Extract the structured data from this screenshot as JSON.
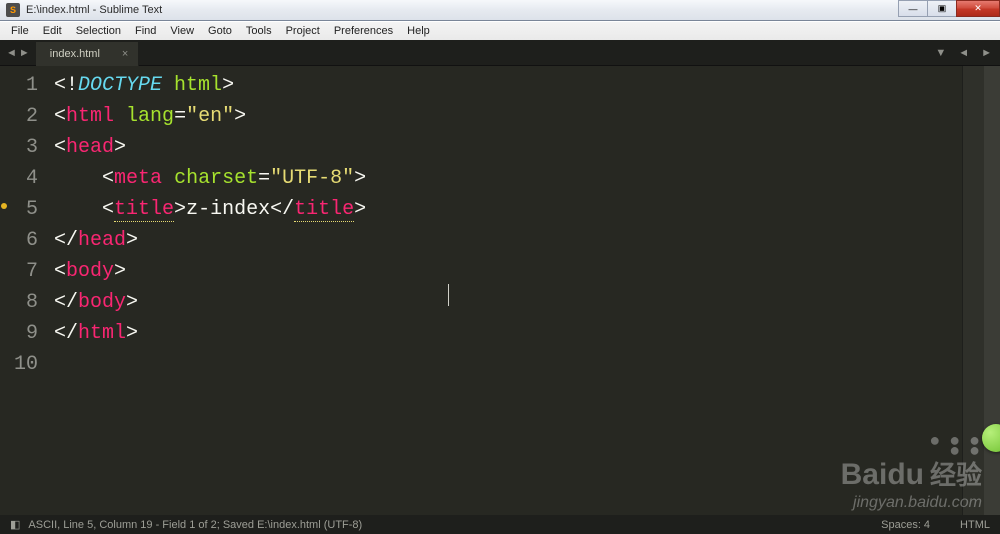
{
  "window": {
    "title": "E:\\index.html - Sublime Text"
  },
  "menu": [
    "File",
    "Edit",
    "Selection",
    "Find",
    "View",
    "Goto",
    "Tools",
    "Project",
    "Preferences",
    "Help"
  ],
  "tab": {
    "label": "index.html"
  },
  "gutter_mark_line": 5,
  "code": {
    "lines": [
      {
        "n": "1",
        "tokens": [
          {
            "t": "<!",
            "c": "tok-punc"
          },
          {
            "t": "DOCTYPE",
            "c": "tok-decl"
          },
          {
            "t": " ",
            "c": "tok-punc"
          },
          {
            "t": "html",
            "c": "tok-attr"
          },
          {
            "t": ">",
            "c": "tok-punc"
          }
        ]
      },
      {
        "n": "2",
        "tokens": [
          {
            "t": "<",
            "c": "tok-punc"
          },
          {
            "t": "html",
            "c": "tok-tag"
          },
          {
            "t": " ",
            "c": "tok-punc"
          },
          {
            "t": "lang",
            "c": "tok-attr"
          },
          {
            "t": "=",
            "c": "tok-punc"
          },
          {
            "t": "\"en\"",
            "c": "tok-str"
          },
          {
            "t": ">",
            "c": "tok-punc"
          }
        ]
      },
      {
        "n": "3",
        "tokens": [
          {
            "t": "<",
            "c": "tok-punc"
          },
          {
            "t": "head",
            "c": "tok-tag"
          },
          {
            "t": ">",
            "c": "tok-punc"
          }
        ]
      },
      {
        "n": "4",
        "indent": 1,
        "tokens": [
          {
            "t": "<",
            "c": "tok-punc"
          },
          {
            "t": "meta",
            "c": "tok-tag"
          },
          {
            "t": " ",
            "c": "tok-punc"
          },
          {
            "t": "charset",
            "c": "tok-attr"
          },
          {
            "t": "=",
            "c": "tok-punc"
          },
          {
            "t": "\"UTF-8\"",
            "c": "tok-str"
          },
          {
            "t": ">",
            "c": "tok-punc"
          }
        ]
      },
      {
        "n": "5",
        "indent": 1,
        "tokens": [
          {
            "t": "<",
            "c": "tok-punc"
          },
          {
            "t": "title",
            "c": "tok-tag",
            "u": true
          },
          {
            "t": ">",
            "c": "tok-punc"
          },
          {
            "t": "z-index",
            "c": "tok-txt"
          },
          {
            "t": "</",
            "c": "tok-punc"
          },
          {
            "t": "title",
            "c": "tok-tag",
            "u": true
          },
          {
            "t": ">",
            "c": "tok-punc"
          }
        ]
      },
      {
        "n": "6",
        "tokens": [
          {
            "t": "</",
            "c": "tok-punc"
          },
          {
            "t": "head",
            "c": "tok-tag"
          },
          {
            "t": ">",
            "c": "tok-punc"
          }
        ]
      },
      {
        "n": "7",
        "tokens": [
          {
            "t": "<",
            "c": "tok-punc"
          },
          {
            "t": "body",
            "c": "tok-tag"
          },
          {
            "t": ">",
            "c": "tok-punc"
          }
        ]
      },
      {
        "n": "8",
        "tokens": []
      },
      {
        "n": "9",
        "tokens": [
          {
            "t": "</",
            "c": "tok-punc"
          },
          {
            "t": "body",
            "c": "tok-tag"
          },
          {
            "t": ">",
            "c": "tok-punc"
          }
        ]
      },
      {
        "n": "10",
        "tokens": [
          {
            "t": "</",
            "c": "tok-punc"
          },
          {
            "t": "html",
            "c": "tok-tag"
          },
          {
            "t": ">",
            "c": "tok-punc"
          }
        ]
      }
    ]
  },
  "status": {
    "left": "ASCII, Line 5, Column 19 - Field 1 of 2; Saved E:\\index.html (UTF-8)",
    "spaces": "Spaces: 4",
    "syntax": "HTML"
  },
  "watermark": {
    "brand": "Baidu",
    "cn": "经验",
    "sub": "jingyan.baidu.com"
  },
  "nav": {
    "back": "◄",
    "fwd": "►",
    "down": "▼",
    "close": "×"
  },
  "win": {
    "min": "—",
    "max": "▣",
    "close": "✕"
  }
}
